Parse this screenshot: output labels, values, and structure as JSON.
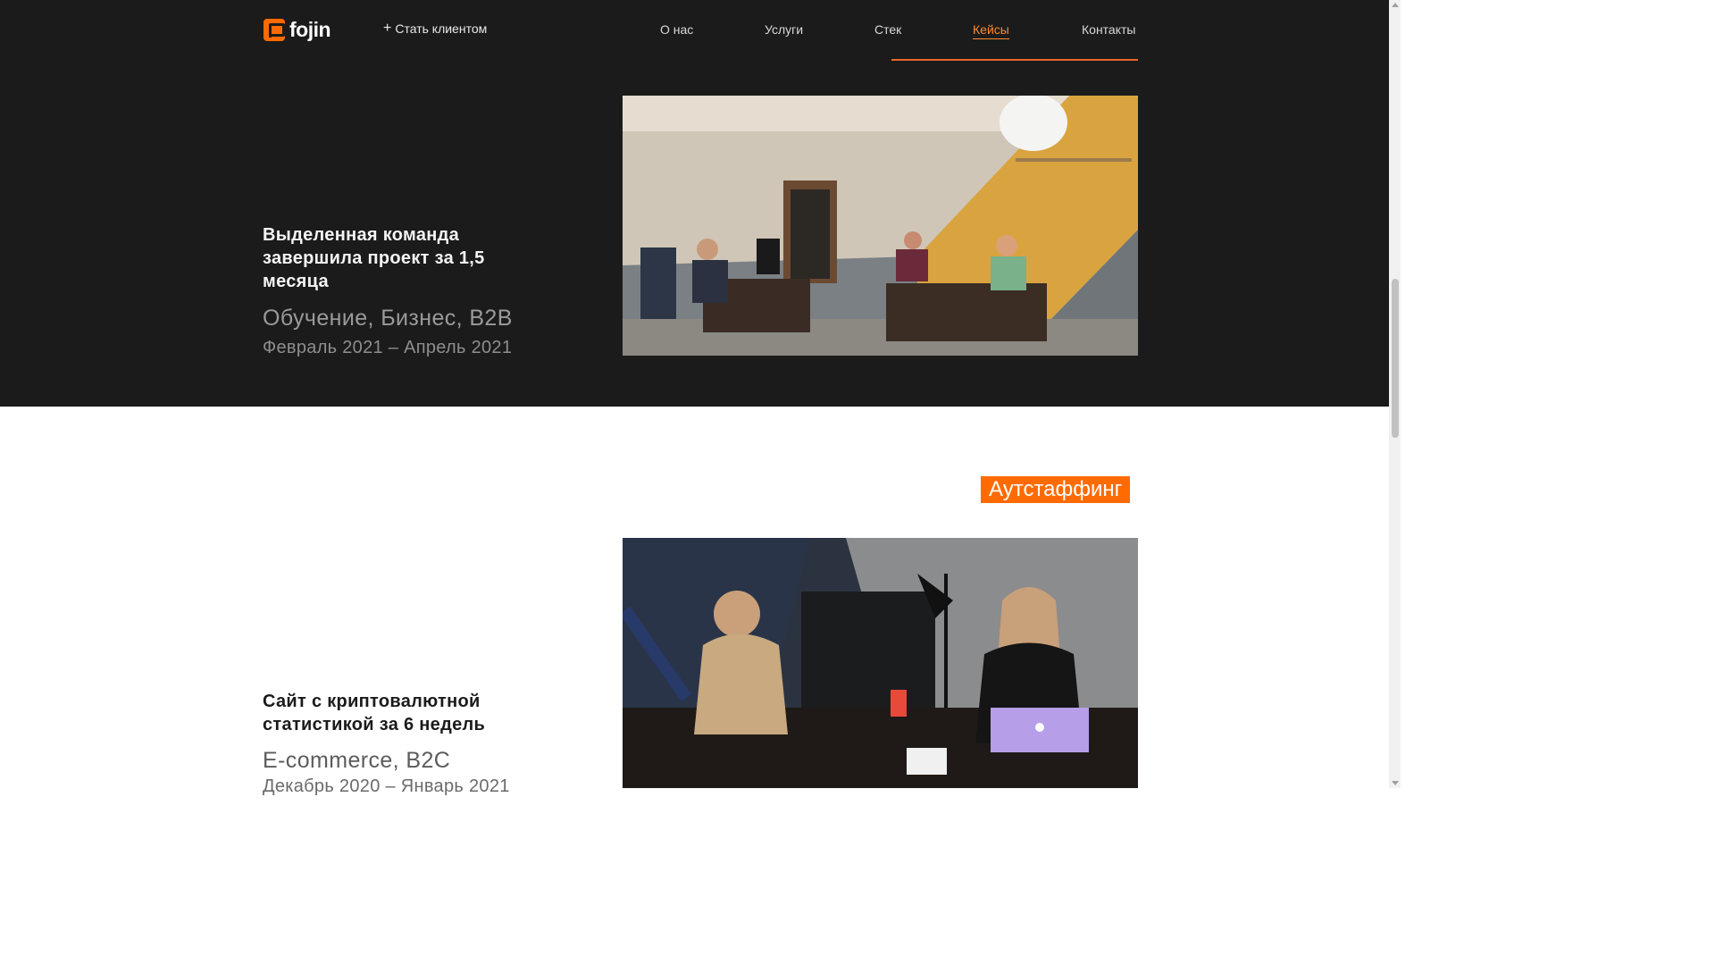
{
  "header": {
    "logo_text": "fojin",
    "cta_label": "Стать клиентом",
    "nav": [
      {
        "label": "О нас"
      },
      {
        "label": "Услуги"
      },
      {
        "label": "Стек"
      },
      {
        "label": "Кейсы"
      },
      {
        "label": "Контакты"
      }
    ],
    "active_nav": "Кейсы"
  },
  "cases": [
    {
      "title_lines": [
        "Выделенная команда",
        "завершила проект за 1,5",
        "месяца"
      ],
      "tags": "Обучение, Бизнес, B2B",
      "dates": "Февраль 2021 – Апрель 2021",
      "photo_icon": "office-photo"
    },
    {
      "badge": "Аутстаффинг",
      "title_lines": [
        "Сайт с криптовалютной",
        "статистикой за 6 недель"
      ],
      "tags": "E-commerce, B2C",
      "dates": "Декабрь 2020 – Январь 2021",
      "photo_icon": "meeting-photo"
    }
  ],
  "colors": {
    "accent": "#ff6b00",
    "dark_bg": "#1b1b1b",
    "light_bg": "#ffffff"
  }
}
